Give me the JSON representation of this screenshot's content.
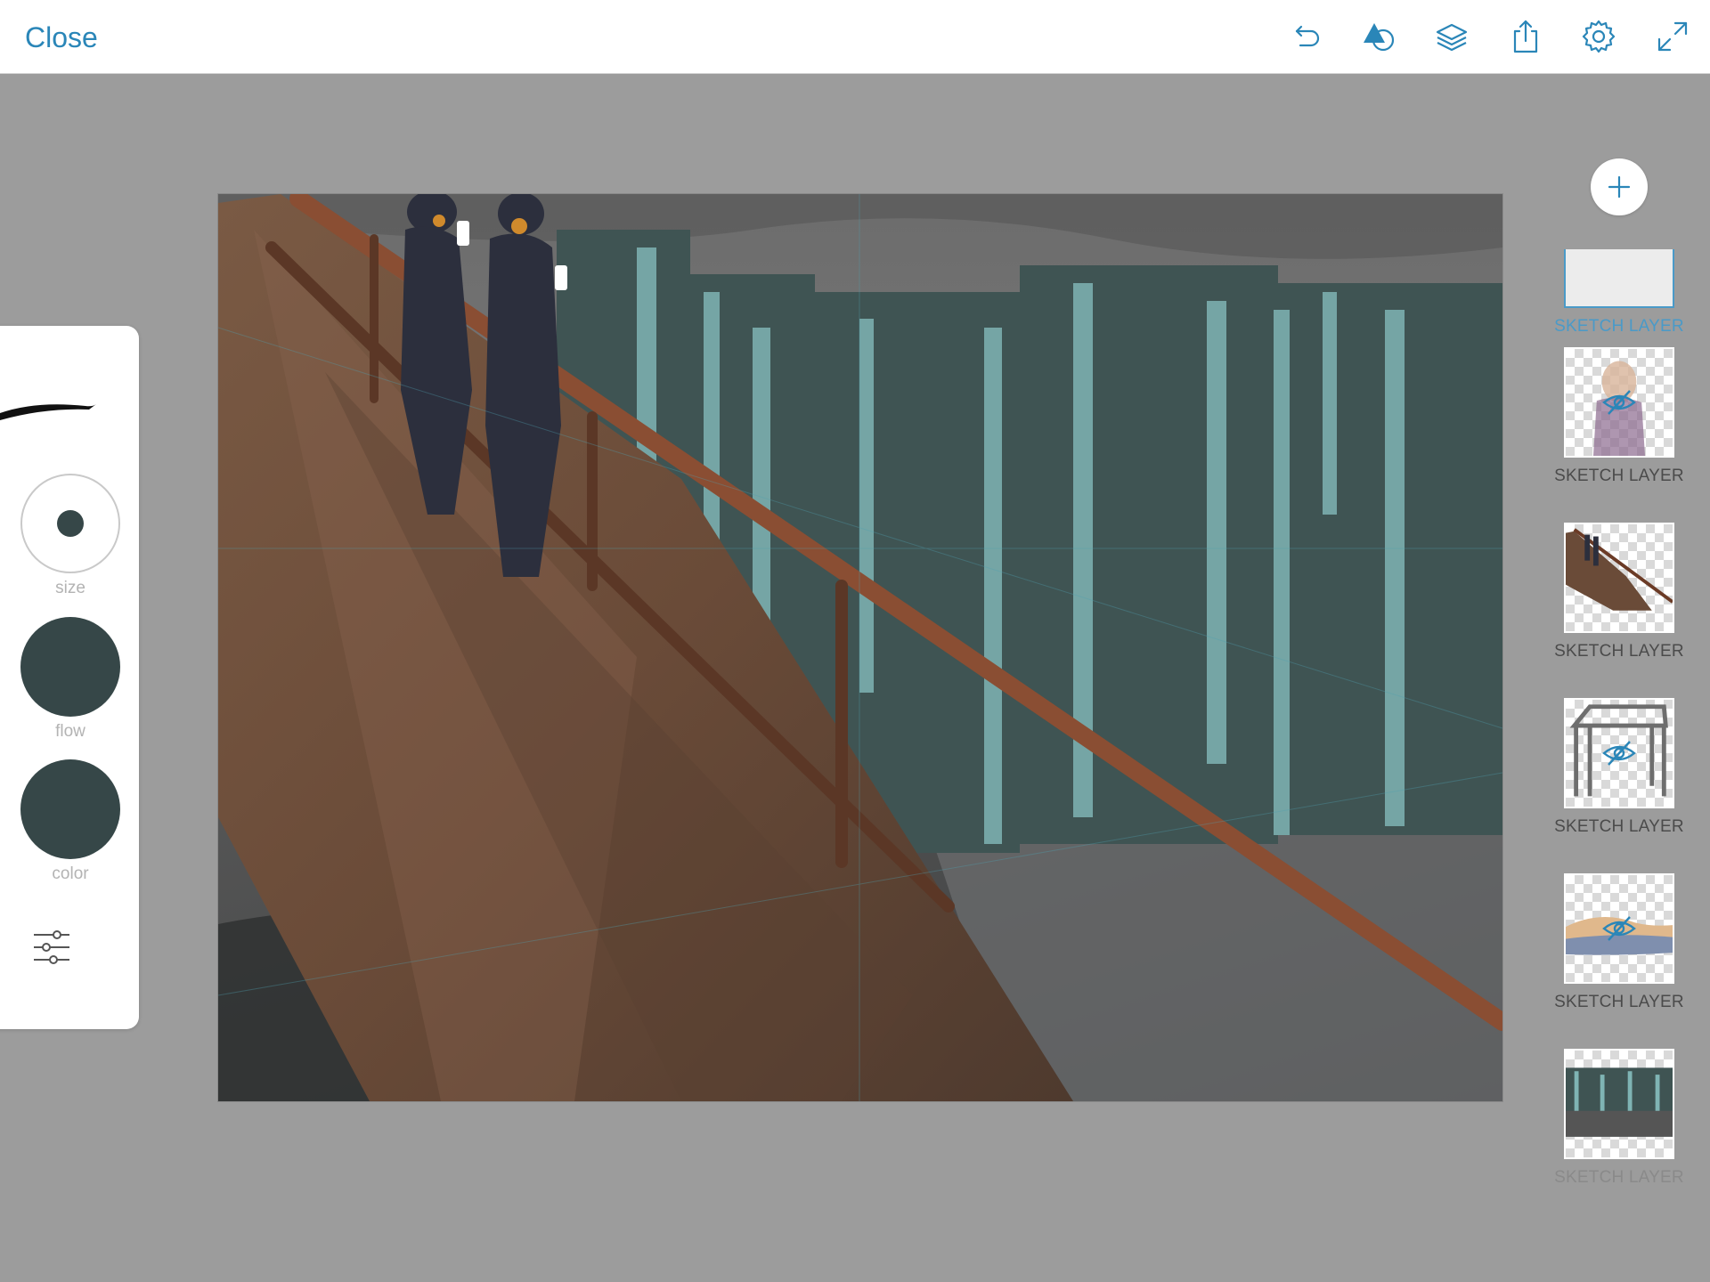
{
  "topbar": {
    "close_label": "Close",
    "icons": [
      "undo-icon",
      "shapes-icon",
      "layers-icon",
      "share-icon",
      "settings-icon",
      "fullscreen-icon"
    ]
  },
  "brush_panel": {
    "size_label": "size",
    "flow_label": "flow",
    "color_label": "color",
    "current_color": "#364748"
  },
  "layers": {
    "add_icon": "plus-icon",
    "items": [
      {
        "label": "SKETCH LAYER",
        "state": "selected",
        "hidden": false
      },
      {
        "label": "SKETCH LAYER",
        "state": "normal",
        "hidden": true
      },
      {
        "label": "SKETCH LAYER",
        "state": "normal",
        "hidden": false
      },
      {
        "label": "SKETCH LAYER",
        "state": "normal",
        "hidden": true
      },
      {
        "label": "SKETCH LAYER",
        "state": "normal",
        "hidden": true
      },
      {
        "label": "SKETCH LAYER",
        "state": "normal",
        "hidden": false
      }
    ]
  },
  "colors": {
    "accent": "#2a86b8",
    "workspace": "#9c9c9c",
    "brush": "#364748"
  }
}
